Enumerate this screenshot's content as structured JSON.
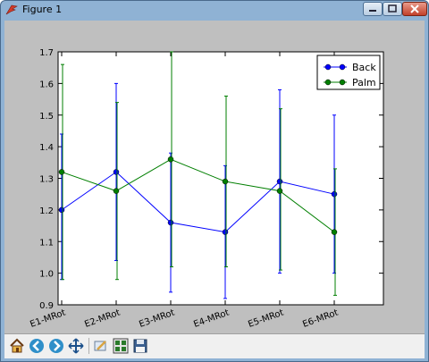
{
  "window": {
    "title": "Figure 1"
  },
  "toolbar": {
    "buttons": [
      {
        "name": "home-button",
        "icon": "home-icon"
      },
      {
        "name": "back-button",
        "icon": "back-arrow-icon"
      },
      {
        "name": "forward-button",
        "icon": "forward-arrow-icon"
      },
      {
        "name": "pan-button",
        "icon": "pan-move-icon"
      },
      {
        "name": "zoom-button",
        "icon": "zoom-rect-icon"
      },
      {
        "name": "configure-subplots-button",
        "icon": "subplots-icon"
      },
      {
        "name": "save-button",
        "icon": "save-disk-icon"
      }
    ]
  },
  "chart_data": {
    "type": "line",
    "categories": [
      "E1-MRot",
      "E2-MRot",
      "E3-MRot",
      "E4-MRot",
      "E5-MRot",
      "E6-MRot"
    ],
    "ylim": [
      0.9,
      1.7
    ],
    "yticks": [
      "0.9",
      "1.0",
      "1.1",
      "1.2",
      "1.3",
      "1.4",
      "1.5",
      "1.6",
      "1.7"
    ],
    "legend_position": "top-right",
    "grid": false,
    "series": [
      {
        "name": "Back",
        "color": "#0000ff",
        "values": [
          1.2,
          1.32,
          1.16,
          1.13,
          1.29,
          1.25
        ],
        "err_low": [
          0.98,
          1.04,
          0.94,
          0.92,
          1.0,
          1.0
        ],
        "err_high": [
          1.44,
          1.6,
          1.38,
          1.34,
          1.58,
          1.5
        ]
      },
      {
        "name": "Palm",
        "color": "#007f00",
        "values": [
          1.32,
          1.26,
          1.36,
          1.29,
          1.26,
          1.13
        ],
        "err_low": [
          0.98,
          0.98,
          1.02,
          1.02,
          1.01,
          0.93
        ],
        "err_high": [
          1.66,
          1.54,
          1.7,
          1.56,
          1.52,
          1.33
        ]
      }
    ]
  }
}
